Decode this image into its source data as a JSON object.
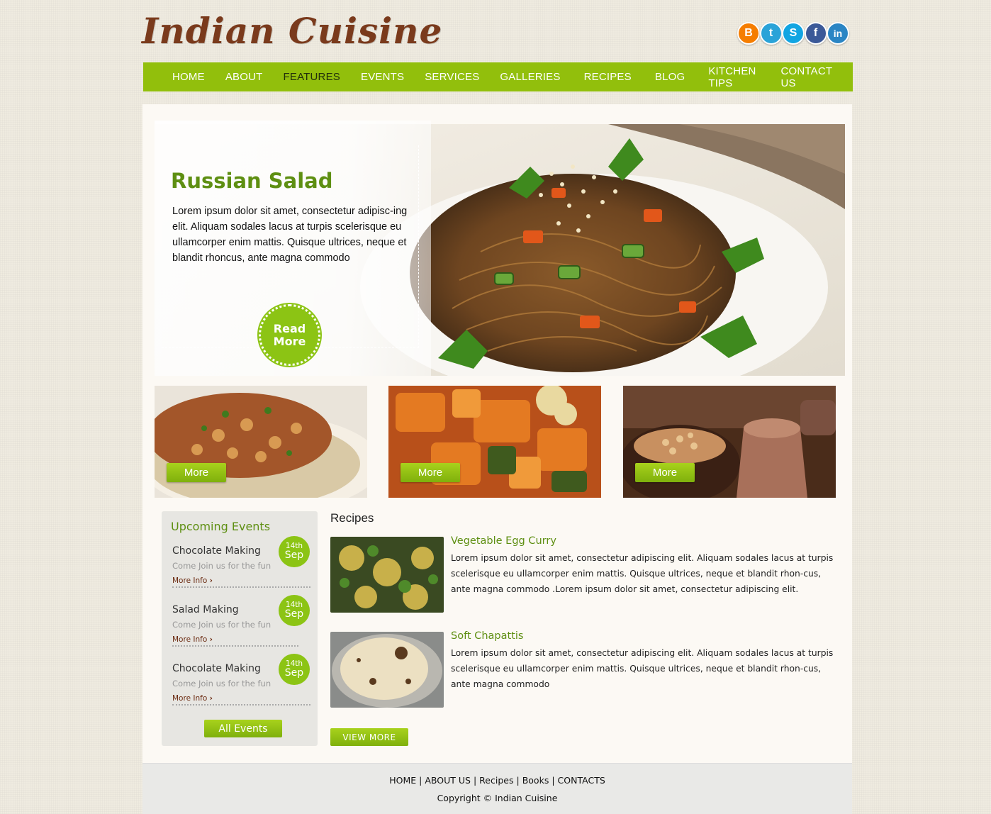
{
  "brand": {
    "logo_text": "Indian Cuisine"
  },
  "social": [
    {
      "name": "blogger-icon",
      "glyph": "B",
      "color": "#f57d00"
    },
    {
      "name": "twitter-icon",
      "glyph": "t",
      "color": "#2aa3d8"
    },
    {
      "name": "skype-icon",
      "glyph": "S",
      "color": "#12a5e2"
    },
    {
      "name": "facebook-icon",
      "glyph": "f",
      "color": "#3b5998"
    },
    {
      "name": "linkedin-icon",
      "glyph": "in",
      "color": "#2a85c4"
    }
  ],
  "nav": {
    "items": [
      "HOME",
      "ABOUT",
      "FEATURES",
      "EVENTS",
      "SERVICES",
      "GALLERIES",
      "RECIPES",
      "BLOG",
      "KITCHEN TIPS",
      "CONTACT US"
    ],
    "active": "FEATURES"
  },
  "hero": {
    "title": "Russian Salad",
    "text": "Lorem ipsum dolor sit amet, consectetur adipisc-ing elit. Aliquam sodales lacus at turpis scelerisque eu ullamcorper enim mattis. Quisque ultrices, neque et blandit rhoncus, ante magna commodo",
    "read_more_line1": "Read",
    "read_more_line2": "More"
  },
  "thumbs": [
    {
      "button": "More"
    },
    {
      "button": "More"
    },
    {
      "button": "More"
    }
  ],
  "events": {
    "title": "Upcoming Events",
    "items": [
      {
        "name": "Chocolate Making",
        "sub": "Come Join us for the fun",
        "more": "More Info",
        "day": "14th",
        "month": "Sep"
      },
      {
        "name": "Salad Making",
        "sub": "Come Join us for the fun",
        "more": "More Info",
        "day": "14th",
        "month": "Sep"
      },
      {
        "name": "Chocolate Making",
        "sub": "Come Join us for the fun",
        "more": "More Info",
        "day": "14th",
        "month": "Sep"
      }
    ],
    "all_label": "All Events"
  },
  "recipes": {
    "title": "Recipes",
    "items": [
      {
        "title": "Vegetable Egg Curry",
        "text": "Lorem ipsum dolor sit amet, consectetur adipiscing elit. Aliquam sodales lacus at turpis scelerisque eu ullamcorper enim mattis. Quisque ultrices, neque et blandit rhon-cus, ante magna commodo .Lorem ipsum dolor sit amet, consectetur adipiscing elit."
      },
      {
        "title": "Soft Chapattis",
        "text": "Lorem ipsum dolor sit amet, consectetur adipiscing elit. Aliquam sodales lacus at turpis scelerisque eu ullamcorper enim mattis. Quisque ultrices, neque et blandit rhon-cus, ante magna commodo"
      }
    ],
    "view_more": "VIEW MORE"
  },
  "footer": {
    "links": [
      "HOME",
      "ABOUT US",
      "Recipes",
      "Books",
      "CONTACTS"
    ],
    "copyright": "Copyright © Indian Cuisine"
  }
}
